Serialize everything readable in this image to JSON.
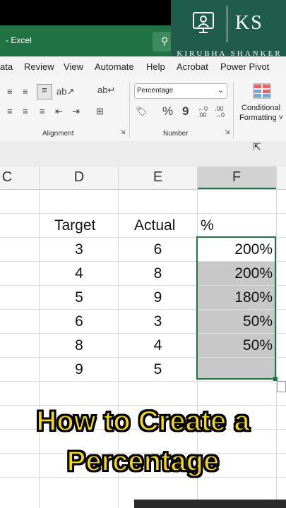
{
  "window": {
    "title": "- Excel",
    "search_icon": "search-icon"
  },
  "logo": {
    "initials": "KS",
    "name": "KIRUBHA SHANKER",
    "bg_color": "#1f5c4a"
  },
  "menu": [
    "ata",
    "Review",
    "View",
    "Automate",
    "Help",
    "Acrobat",
    "Power Pivot"
  ],
  "ribbon": {
    "alignment_label": "Alignment",
    "number_label": "Number",
    "number_format": "Percentage",
    "percent_symbol": "%",
    "comma_symbol": "9",
    "increase_decimal": "←0 .00",
    "decrease_decimal": ".00 →0",
    "conditional_formatting_line1": "Conditional",
    "conditional_formatting_line2": "Formatting ˅"
  },
  "grid": {
    "columns": [
      "C",
      "D",
      "E",
      "F"
    ],
    "header_row": {
      "d": "Target",
      "e": "Actual",
      "f": "%"
    },
    "rows": [
      {
        "d": "3",
        "e": "6",
        "f": "200%"
      },
      {
        "d": "4",
        "e": "8",
        "f": "200%"
      },
      {
        "d": "5",
        "e": "9",
        "f": "180%"
      },
      {
        "d": "6",
        "e": "3",
        "f": "50%"
      },
      {
        "d": "8",
        "e": "4",
        "f": "50%"
      },
      {
        "d": "9",
        "e": "5",
        "f": ""
      }
    ]
  },
  "caption": {
    "line1": "How to Create a",
    "line2": "Percentage",
    "color": "#f4d71b"
  }
}
